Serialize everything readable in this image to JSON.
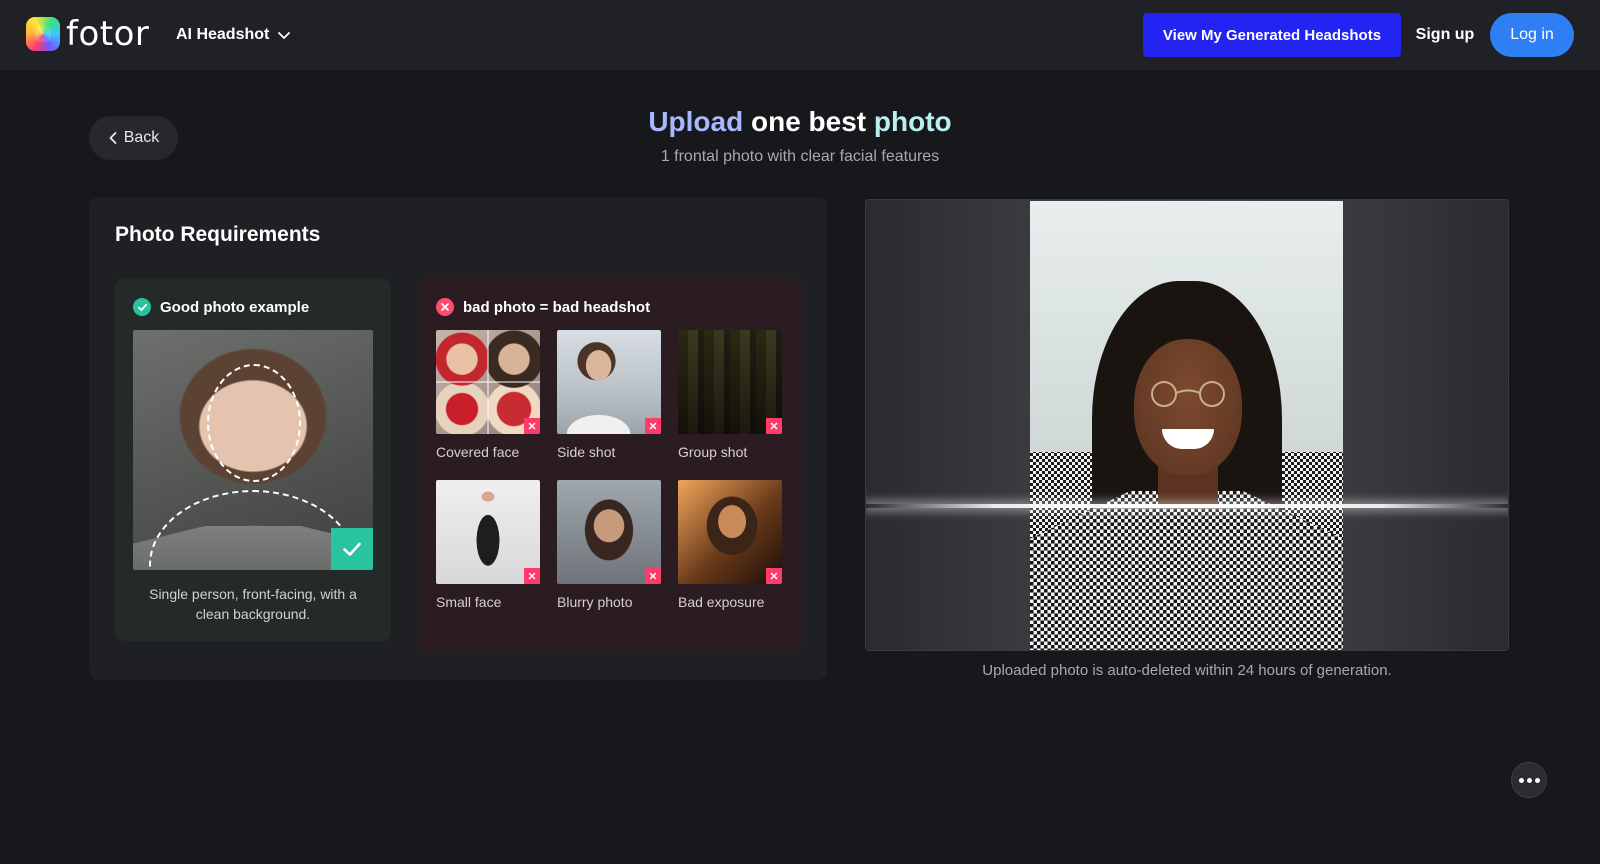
{
  "header": {
    "logo_text": "fotor",
    "product_menu_label": "AI Headshot",
    "generated_button_label": "View My Generated Headshots",
    "signup_label": "Sign up",
    "login_label": "Log in"
  },
  "title": {
    "back_label": "Back",
    "word1": "Upload",
    "word2": "one best",
    "word3": "photo",
    "subtitle": "1 frontal photo with clear facial features"
  },
  "requirements": {
    "heading": "Photo Requirements",
    "good": {
      "label": "Good photo example",
      "caption": "Single person, front-facing, with a clean background."
    },
    "bad": {
      "label": "bad photo = bad headshot",
      "items": [
        {
          "label": "Covered face",
          "thumb": "t-covered"
        },
        {
          "label": "Side shot",
          "thumb": "t-side"
        },
        {
          "label": "Group shot",
          "thumb": "t-group"
        },
        {
          "label": "Small face",
          "thumb": "t-small"
        },
        {
          "label": "Blurry photo",
          "thumb": "t-blurry"
        },
        {
          "label": "Bad exposure",
          "thumb": "t-exposure"
        }
      ]
    }
  },
  "preview": {
    "note": "Uploaded photo is auto-deleted within 24 hours of generation."
  },
  "colors": {
    "accent_blue": "#2323f2",
    "login_blue": "#2f7ff4",
    "good_green": "#29c3a0",
    "bad_red": "#ff3b6b",
    "background": "#17181c"
  },
  "icons": {
    "back": "chevron-left-icon",
    "menu": "chevron-down-icon",
    "good": "check-circle-icon",
    "bad": "x-circle-icon",
    "more": "more-dots-icon"
  }
}
